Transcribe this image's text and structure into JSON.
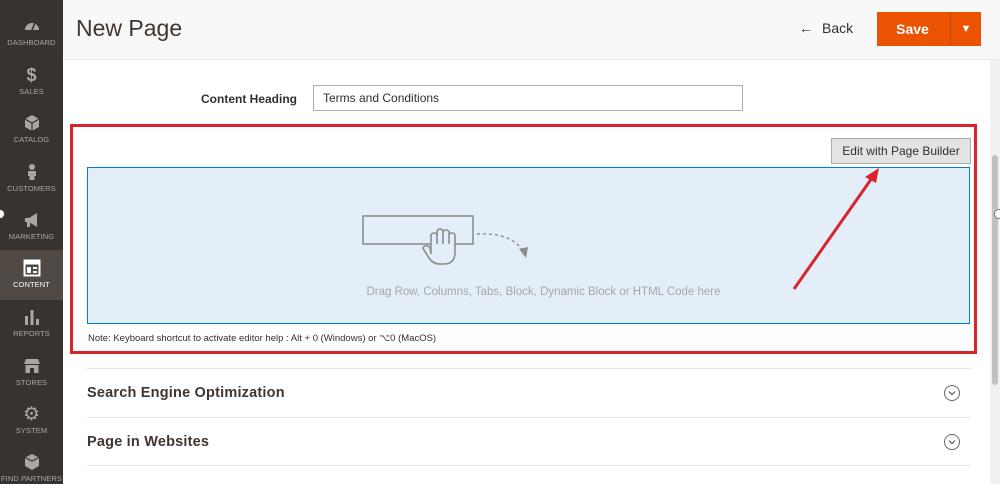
{
  "sidebar": {
    "items": [
      {
        "label": "DASHBOARD",
        "icon": "dashboard-icon"
      },
      {
        "label": "SALES",
        "icon": "dollar-icon"
      },
      {
        "label": "CATALOG",
        "icon": "cube-icon"
      },
      {
        "label": "CUSTOMERS",
        "icon": "person-icon"
      },
      {
        "label": "MARKETING",
        "icon": "megaphone-icon"
      },
      {
        "label": "CONTENT",
        "icon": "layout-icon",
        "active": true
      },
      {
        "label": "REPORTS",
        "icon": "bar-chart-icon"
      },
      {
        "label": "STORES",
        "icon": "store-icon"
      },
      {
        "label": "SYSTEM",
        "icon": "gear-icon"
      },
      {
        "label": "FIND PARTNERS",
        "icon": "box-icon"
      }
    ]
  },
  "header": {
    "title": "New Page",
    "back_label": "Back",
    "save_label": "Save"
  },
  "form": {
    "content_heading_label": "Content Heading",
    "content_heading_value": "Terms and Conditions"
  },
  "page_builder": {
    "edit_button_label": "Edit with Page Builder",
    "drop_text": "Drag Row, Columns, Tabs, Block, Dynamic Block or HTML Code here",
    "note": "Note: Keyboard shortcut to activate editor help : Alt + 0 (Windows) or ⌥0 (MacOS)"
  },
  "sections": [
    {
      "title": "Search Engine Optimization"
    },
    {
      "title": "Page in Websites"
    }
  ],
  "colors": {
    "accent": "#eb5202",
    "sidebar_bg": "#373330",
    "highlight": "#d9232d",
    "dropzone_border": "#007bdb"
  }
}
